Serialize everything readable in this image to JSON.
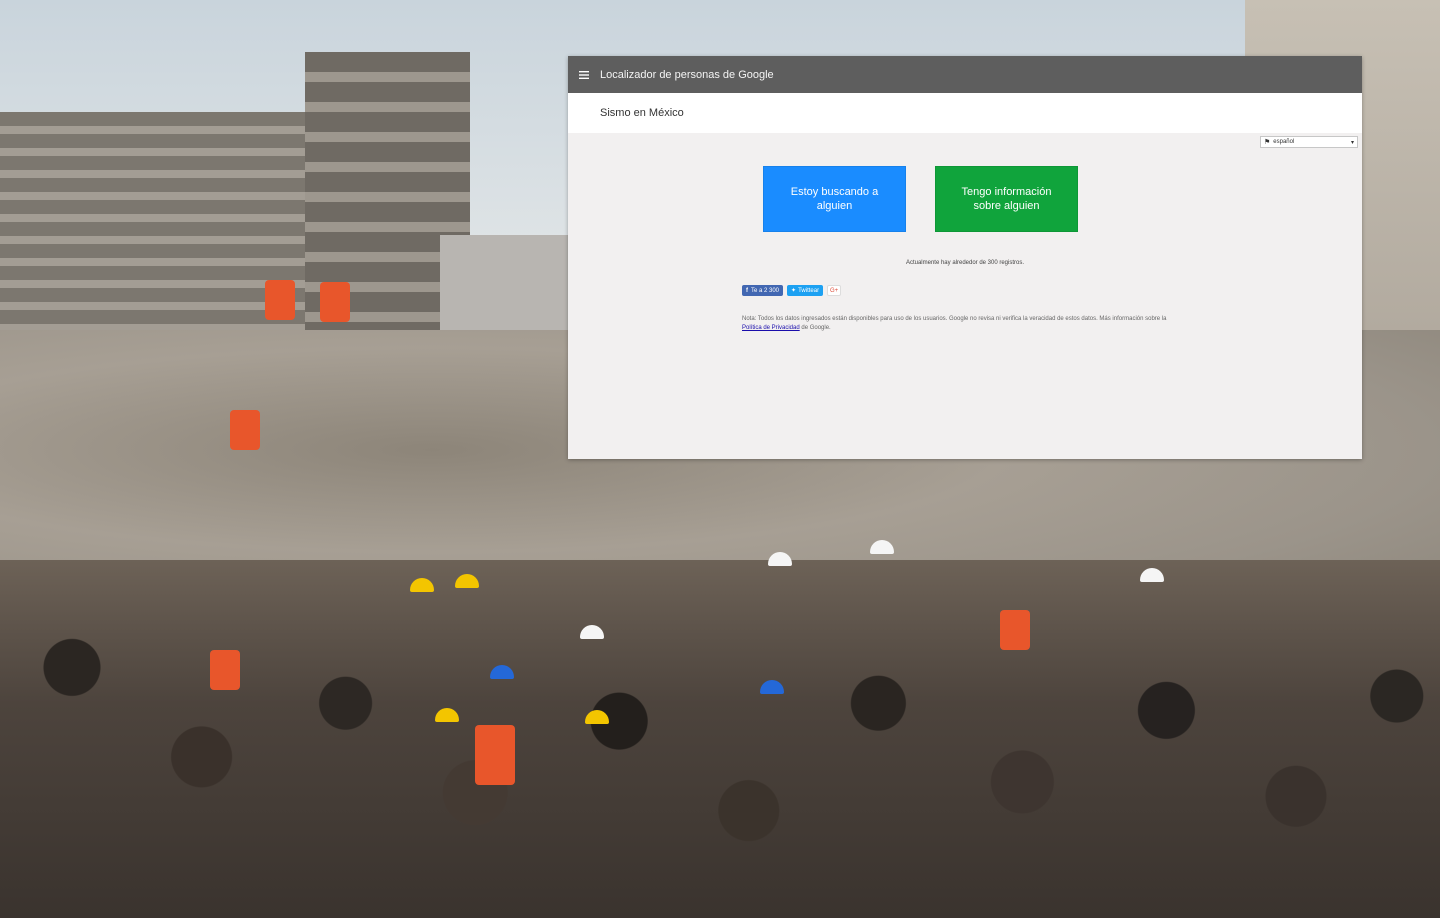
{
  "topbar": {
    "menu_icon": "hamburger-menu-icon",
    "title": "Localizador de personas de Google"
  },
  "repository": {
    "title": "Sismo en México"
  },
  "language": {
    "selected": "español",
    "icon": "language-flag-icon"
  },
  "actions": {
    "seek_label": "Estoy buscando a alguien",
    "info_label": "Tengo información sobre alguien"
  },
  "records_text": "Actualmente hay alrededor de 300 registros.",
  "social": {
    "facebook_label": "Te a 2 300",
    "twitter_label": "Twittear",
    "gplus_label": "G+"
  },
  "note": {
    "text_before": "Nota: Todos los datos ingresados están disponibles para uso de los usuarios. Google no revisa ni verifica la veracidad de estos datos. Más información sobre la ",
    "link": "Política de Privacidad",
    "text_after": " de Google."
  },
  "colors": {
    "topbar": "#5e5e5e",
    "seek_button": "#1a8cff",
    "info_button": "#10a43c",
    "page_background": "#f2f0f0"
  }
}
